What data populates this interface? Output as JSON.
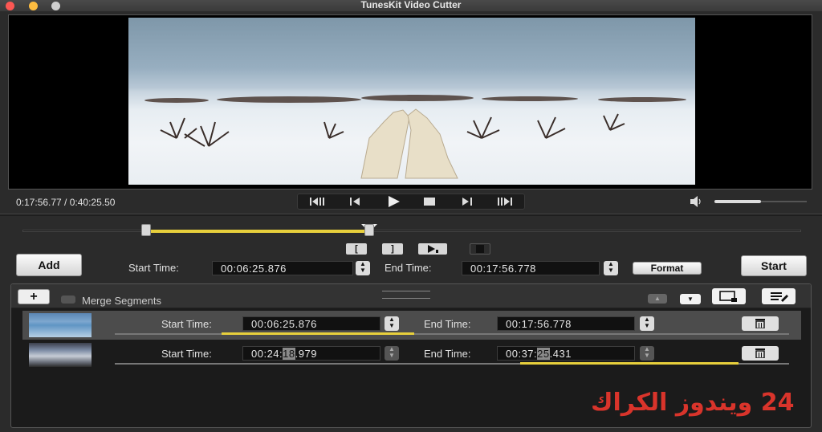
{
  "window": {
    "title": "TunesKit Video Cutter"
  },
  "player": {
    "time_display": "0:17:56.77 / 0:40:25.50",
    "volume_fraction": 0.5,
    "controls": [
      "prev-frame-icon",
      "step-back-icon",
      "play-icon",
      "stop-icon",
      "step-forward-icon",
      "next-frame-icon"
    ]
  },
  "timeline": {
    "range_start_fraction": 0.158,
    "range_end_fraction": 0.444,
    "playhead_fraction": 0.444
  },
  "editor": {
    "add_label": "Add",
    "start_time_label": "Start Time:",
    "start_time_value": "00:06:25.876",
    "end_time_label": "End Time:",
    "end_time_value": "00:17:56.778",
    "format_label": "Format",
    "start_label": "Start"
  },
  "segments_panel": {
    "add_symbol": "+",
    "merge_label": "Merge Segments",
    "rows": [
      {
        "start_label": "Start Time:",
        "start_value": "00:06:25.876",
        "end_label": "End Time:",
        "end_value": "00:17:56.778",
        "selected": true
      },
      {
        "start_label": "Start Time:",
        "start_pre": "00:24:",
        "start_highlight": "18",
        "start_post": ".979",
        "end_label": "End Time:",
        "end_pre": "00:37:",
        "end_highlight": "25",
        "end_post": ".431",
        "selected": false
      }
    ]
  },
  "watermark": "24 ويندوز الكراك",
  "colors": {
    "accent_yellow": "#e7cf3c",
    "background": "#2b2b2b"
  }
}
